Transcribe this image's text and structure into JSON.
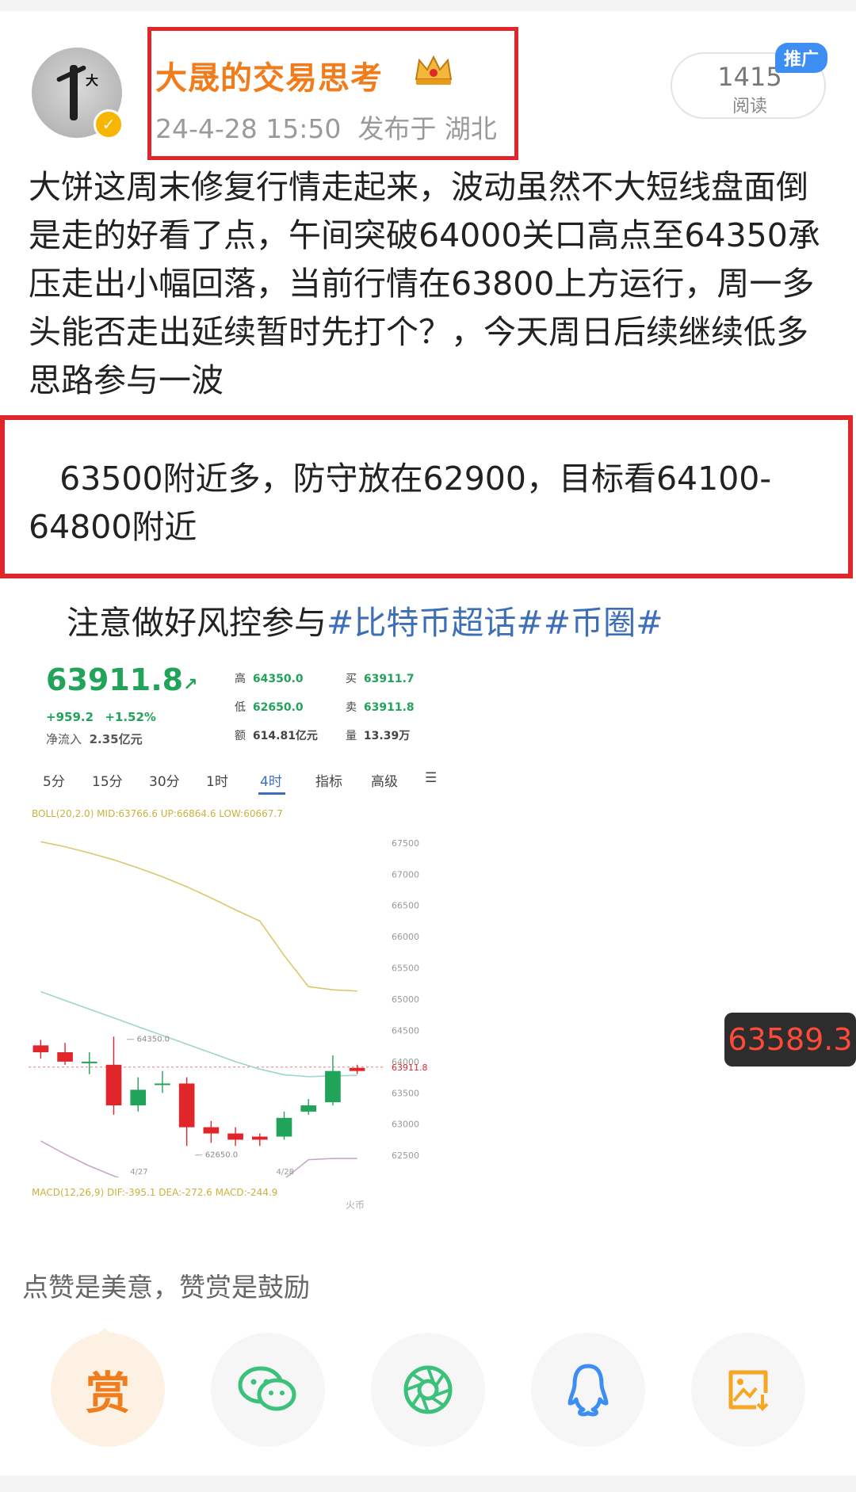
{
  "header": {
    "username": "大晟的交易思考",
    "timestamp": "24-4-28 15:50",
    "location": "发布于 湖北",
    "read_count": "1415",
    "read_label": "阅读",
    "promo_badge": "推广",
    "avatar_text": "大",
    "verified_icon": "verified-check-icon"
  },
  "post": {
    "paragraph1": "大饼这周末修复行情走起来，波动虽然不大短线盘面倒是走的好看了点，午间突破64000关口高点至64350承压走出小幅回落，当前行情在63800上方运行，周一多头能否走出延续暂时先打个？，今天周日后续继续低多思路参与一波",
    "paragraph2": "63500附近多，防守放在62900，目标看64100-64800附近",
    "paragraph3_prefix": "注意做好风控参与",
    "hashtag1": "#比特币超话#",
    "hashtag2": "#币圈#"
  },
  "chart_screenshot": {
    "price": "63911.8",
    "arrow": "↗",
    "change_abs": "+959.2",
    "change_pct": "+1.52%",
    "net_inflow_label": "净流入",
    "net_inflow": "2.35亿元",
    "high_label": "高",
    "high": "64350.0",
    "low_label": "低",
    "low": "62650.0",
    "amount_label": "额",
    "amount": "614.81亿元",
    "bid_label": "买",
    "bid": "63911.7",
    "ask_label": "卖",
    "ask": "63911.8",
    "vol_label": "量",
    "vol": "13.39万",
    "tabs": [
      "5分",
      "15分",
      "30分",
      "1时",
      "4时",
      "指标",
      "高级"
    ],
    "active_tab": "4时",
    "boll_line": "BOLL(20,2.0) MID:63766.6 UP:66864.6 LOW:60667.7",
    "macd_line": "MACD(12,26,9) DIF:-395.1 DEA:-272.6 MACD:-244.9",
    "date_labels": [
      "4/27",
      "4/28"
    ],
    "high_marker": "64350.0",
    "low_marker": "62650.0",
    "current_marker": "63911.8",
    "y_axis_ticks": [
      "67500",
      "67000",
      "66500",
      "66000",
      "65500",
      "65000",
      "64500",
      "64000",
      "63500",
      "63000",
      "62500"
    ],
    "watermark": "火币",
    "candles": [
      {
        "o": 64260,
        "c": 64150,
        "h": 64350,
        "l": 64050
      },
      {
        "o": 64150,
        "c": 64000,
        "h": 64300,
        "l": 63950
      },
      {
        "o": 64000,
        "c": 64000,
        "h": 64150,
        "l": 63800
      },
      {
        "o": 63950,
        "c": 63300,
        "h": 64400,
        "l": 63150
      },
      {
        "o": 63300,
        "c": 63550,
        "h": 63750,
        "l": 63200
      },
      {
        "o": 63650,
        "c": 63650,
        "h": 63850,
        "l": 63500
      },
      {
        "o": 63650,
        "c": 62950,
        "h": 63750,
        "l": 62650
      },
      {
        "o": 62950,
        "c": 62850,
        "h": 63050,
        "l": 62700
      },
      {
        "o": 62850,
        "c": 62750,
        "h": 62950,
        "l": 62650
      },
      {
        "o": 62800,
        "c": 62750,
        "h": 62850,
        "l": 62650
      },
      {
        "o": 62800,
        "c": 63100,
        "h": 63200,
        "l": 62750
      },
      {
        "o": 63200,
        "c": 63300,
        "h": 63400,
        "l": 63150
      },
      {
        "o": 63350,
        "c": 63850,
        "h": 64100,
        "l": 63300
      },
      {
        "o": 63900,
        "c": 63850,
        "h": 63950,
        "l": 63800
      }
    ],
    "boll_upper": [
      67520,
      67440,
      67340,
      67230,
      67100,
      66960,
      66800,
      66620,
      66430,
      66250,
      65700,
      65200,
      65150,
      65130
    ],
    "boll_mid": [
      65120,
      64980,
      64840,
      64700,
      64560,
      64420,
      64280,
      64140,
      64000,
      63880,
      63790,
      63760,
      63770,
      63780
    ],
    "boll_lower": [
      62730,
      62520,
      62330,
      62170,
      62030,
      61900,
      61790,
      61720,
      61690,
      61730,
      62120,
      62430,
      62450,
      62450
    ]
  },
  "floating_price": "63589.3",
  "reward": {
    "caption": "点赞是美意，赞赏是鼓励",
    "button_label": "赏"
  },
  "share_buttons": [
    {
      "name": "reward-button",
      "icon": "reward-icon"
    },
    {
      "name": "share-wechat-button",
      "icon": "wechat-icon"
    },
    {
      "name": "share-moments-button",
      "icon": "moments-icon"
    },
    {
      "name": "share-qq-button",
      "icon": "qq-icon"
    },
    {
      "name": "save-image-button",
      "icon": "save-image-icon"
    }
  ],
  "colors": {
    "username": "#f07c1b",
    "highlight_border": "#e0262b",
    "hashtag": "#3d6fb6",
    "up_green": "#22a35a",
    "down_red": "#e0262b",
    "boll_upper": "#d9c86a",
    "boll_mid": "#9fd6c8",
    "boll_lower": "#c9a6c6"
  }
}
